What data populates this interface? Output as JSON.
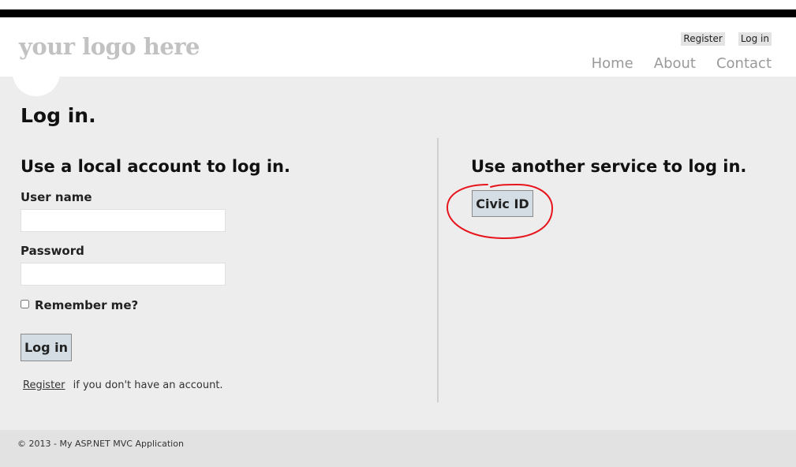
{
  "header": {
    "logo": "your logo here",
    "auth_links": {
      "register": "Register",
      "login": "Log in"
    },
    "menu": {
      "home": "Home",
      "about": "About",
      "contact": "Contact"
    }
  },
  "main": {
    "title": "Log in.",
    "local": {
      "heading": "Use a local account to log in.",
      "username_label": "User name",
      "username_value": "",
      "password_label": "Password",
      "password_value": "",
      "remember_label": "Remember me?",
      "remember_checked": false,
      "submit_label": "Log in",
      "register_link": "Register",
      "register_suffix": "if you don't have an account."
    },
    "external": {
      "heading": "Use another service to log in.",
      "provider_button": "Civic ID"
    },
    "annotation_color": "#e8141c"
  },
  "footer": {
    "copyright": "© 2013 - My ASP.NET MVC Application"
  }
}
